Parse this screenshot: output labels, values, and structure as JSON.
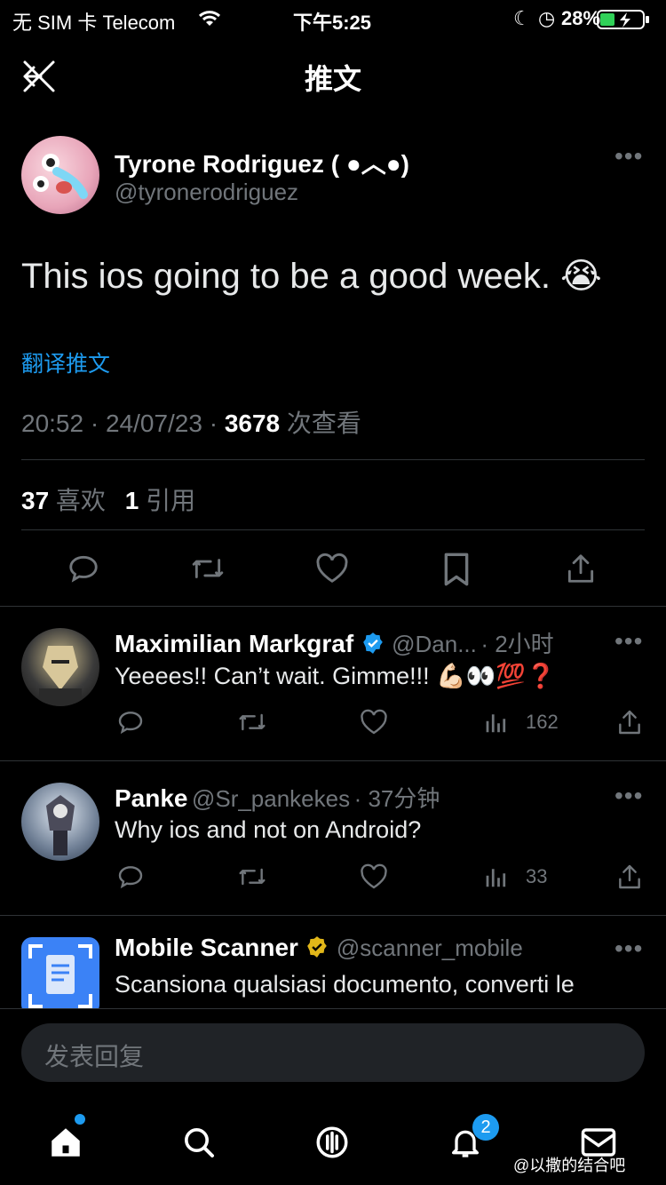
{
  "status_bar": {
    "carrier": "无 SIM 卡 Telecom",
    "time": "下午5:25",
    "battery": "28%"
  },
  "header": {
    "title": "推文"
  },
  "tweet": {
    "name": "Tyrone Rodriguez ( ●︿●)",
    "handle": "@tyronerodriguez",
    "text": "This ios going to be a good week. 😭",
    "translate": "翻译推文",
    "time": "20:52 · 24/07/23 · ",
    "views_count": "3678",
    "views_label": " 次查看",
    "likes_count": "37",
    "likes_label": " 喜欢",
    "quotes_count": "1",
    "quotes_label": " 引用"
  },
  "replies": [
    {
      "name": "Maximilian Markgraf",
      "handle": "@Dan...",
      "time": "· 2小时",
      "text": "Yeeees!! Can’t wait. Gimme!!! 💪🏻👀💯❓",
      "views": "162",
      "verified_color": "#1d9bf0"
    },
    {
      "name": "Panke",
      "handle": "@Sr_pankekes",
      "time": "· 37分钟",
      "text": "Why ios and not on Android?",
      "views": "33"
    },
    {
      "name": "Mobile Scanner",
      "handle": "@scanner_mobile",
      "text": "Scansiona qualsiasi documento, converti le",
      "verified_color": "#e2b719"
    }
  ],
  "reply_box": {
    "placeholder": "发表回复"
  },
  "tabbar": {
    "notifications_badge": "2"
  },
  "watermark": "@以撒的结合吧",
  "colors": {
    "accent": "#1d9bf0",
    "muted": "#71767b",
    "divider": "#2f3336"
  }
}
